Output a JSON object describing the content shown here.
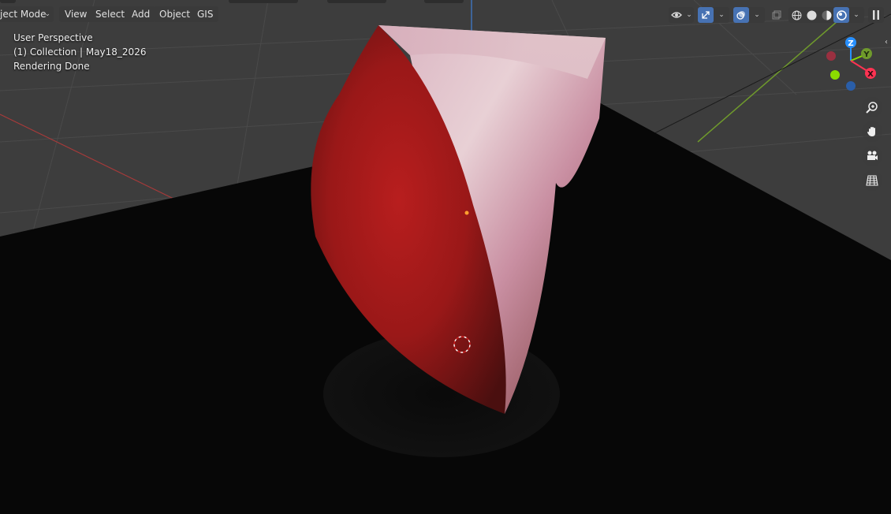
{
  "header": {
    "mode_label": "ject Mode",
    "menu": [
      "View",
      "Select",
      "Add",
      "Object",
      "GIS"
    ]
  },
  "overlay": {
    "view_name": "User Perspective",
    "collection_info": "(1) Collection | May18_2026",
    "render_status": "Rendering Done"
  },
  "gizmo": {
    "z": "Z",
    "y": "Y",
    "x": "X"
  },
  "icons": {
    "visibility": "eye-icon",
    "gizmo_toggle": "gizmo-icon",
    "overlays": "overlays-icon",
    "xray": "xray-icon",
    "shading": [
      "wireframe-icon",
      "solid-icon",
      "material-preview-icon",
      "rendered-icon"
    ],
    "pause": "pause-icon",
    "navigation": [
      "zoom-icon",
      "hand-pan-icon",
      "camera-icon",
      "grid-ortho-icon"
    ]
  },
  "colors": {
    "accent": "#4772b3",
    "axis_x": "#ff3352",
    "axis_y": "#8bdc00",
    "axis_z": "#2890ff"
  }
}
